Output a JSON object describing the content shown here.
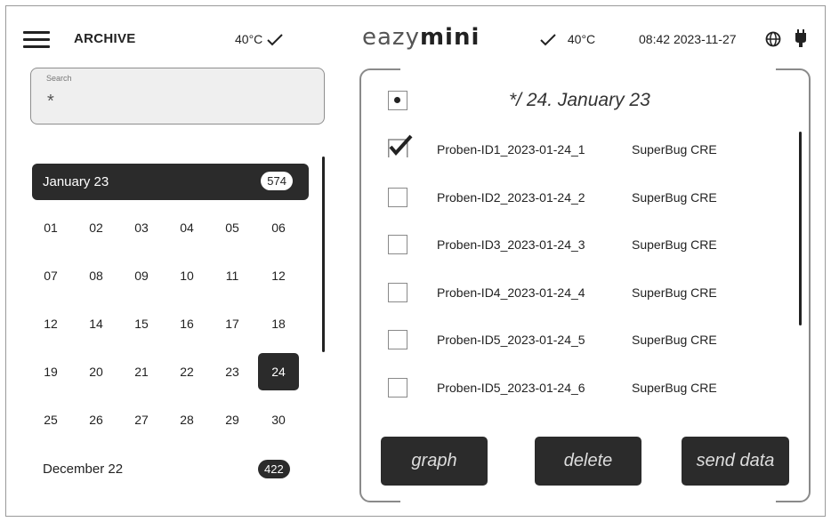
{
  "header": {
    "title": "ARCHIVE",
    "left_temp": "40°C",
    "logo_light": "eazy",
    "logo_bold": "mini",
    "right_temp": "40°C",
    "time": "08:42",
    "date": "2023-11-27"
  },
  "search": {
    "label": "Search",
    "value": "*"
  },
  "calendar": {
    "active_month": {
      "label": "January 23",
      "count": "574"
    },
    "days": [
      "01",
      "02",
      "03",
      "04",
      "05",
      "06",
      "07",
      "08",
      "09",
      "10",
      "11",
      "12",
      "12",
      "14",
      "15",
      "16",
      "17",
      "18",
      "19",
      "20",
      "21",
      "22",
      "23",
      "24",
      "25",
      "26",
      "27",
      "28",
      "29",
      "30"
    ],
    "selected_day": "24",
    "other_month": {
      "label": "December 22",
      "count": "422"
    }
  },
  "samples": {
    "header": "*/ 24. January 23",
    "rows": [
      {
        "id": "Proben-ID1_2023-01-24_1",
        "type": "SuperBug CRE",
        "checked": true
      },
      {
        "id": "Proben-ID2_2023-01-24_2",
        "type": "SuperBug CRE",
        "checked": false
      },
      {
        "id": "Proben-ID3_2023-01-24_3",
        "type": "SuperBug CRE",
        "checked": false
      },
      {
        "id": "Proben-ID4_2023-01-24_4",
        "type": "SuperBug CRE",
        "checked": false
      },
      {
        "id": "Proben-ID5_2023-01-24_5",
        "type": "SuperBug CRE",
        "checked": false
      },
      {
        "id": "Proben-ID5_2023-01-24_6",
        "type": "SuperBug CRE",
        "checked": false
      }
    ]
  },
  "actions": {
    "graph": "graph",
    "delete": "delete",
    "send": "send data"
  },
  "colors": {
    "dark": "#2b2b2b",
    "border": "#8a8a8a"
  },
  "icons": [
    "menu-icon",
    "check-icon",
    "globe-icon",
    "plug-icon",
    "checkbox-checked-icon",
    "radio-dot-icon"
  ]
}
